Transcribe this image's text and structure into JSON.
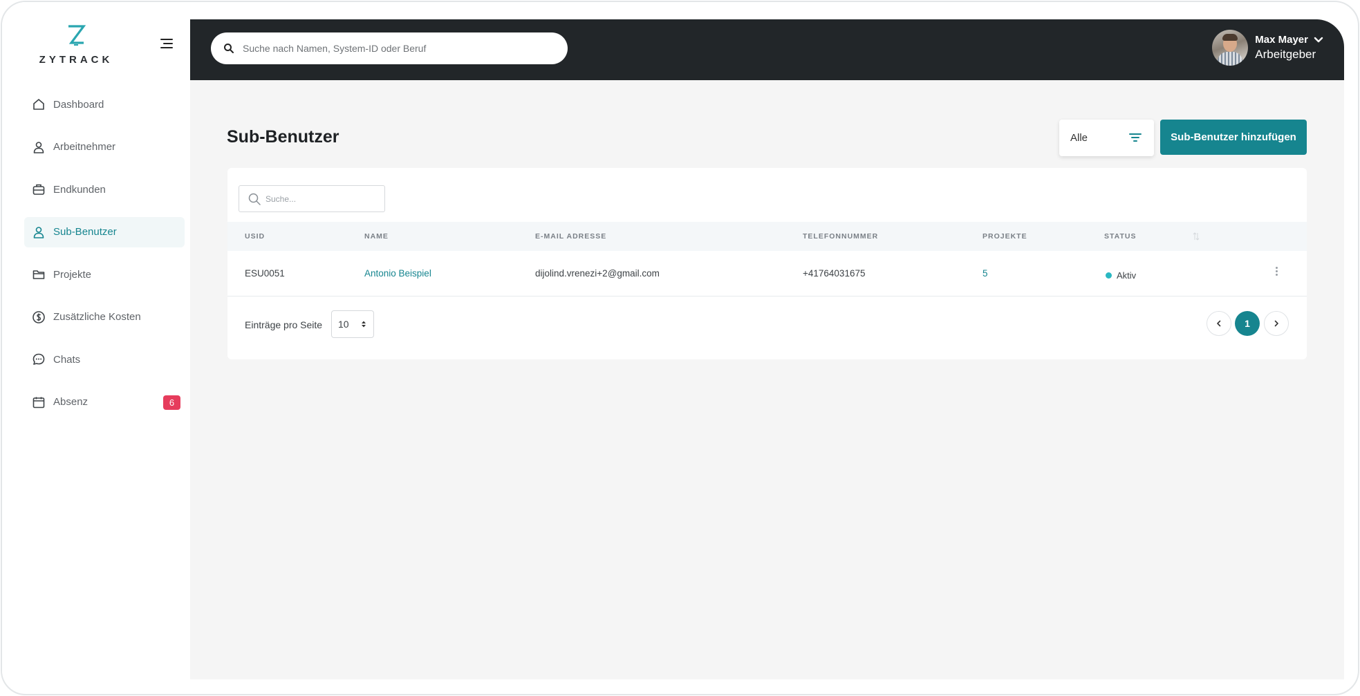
{
  "brand": {
    "name": "ZYTRACK",
    "accent": "#16858f"
  },
  "sidebar": {
    "items": [
      {
        "label": "Dashboard",
        "icon": "home-icon"
      },
      {
        "label": "Arbeitnehmer",
        "icon": "user-icon"
      },
      {
        "label": "Endkunden",
        "icon": "briefcase-icon"
      },
      {
        "label": "Sub-Benutzer",
        "icon": "user-icon",
        "active": true
      },
      {
        "label": "Projekte",
        "icon": "folder-icon"
      },
      {
        "label": "Zusätzliche Kosten",
        "icon": "dollar-icon"
      },
      {
        "label": "Chats",
        "icon": "chat-icon"
      },
      {
        "label": "Absenz",
        "icon": "calendar-icon",
        "badge": "6"
      }
    ]
  },
  "header": {
    "search_placeholder": "Suche nach Namen, System-ID oder Beruf",
    "user_name": "Max Mayer",
    "user_role": "Arbeitgeber"
  },
  "main": {
    "title": "Sub-Benutzer",
    "filter_value": "Alle",
    "add_button": "Sub-Benutzer hinzufügen",
    "table_search_placeholder": "Suche...",
    "columns": [
      "USID",
      "NAME",
      "E-MAIL ADRESSE",
      "TELEFONNUMMER",
      "PROJEKTE",
      "STATUS"
    ],
    "rows": [
      {
        "usid": "ESU0051",
        "name": "Antonio Beispiel",
        "email": "dijolind.vrenezi+2@gmail.com",
        "phone": "+41764031675",
        "projects": "5",
        "status": "Aktiv"
      }
    ],
    "per_page_label": "Einträge pro Seite",
    "per_page_value": "10",
    "current_page": "1"
  }
}
